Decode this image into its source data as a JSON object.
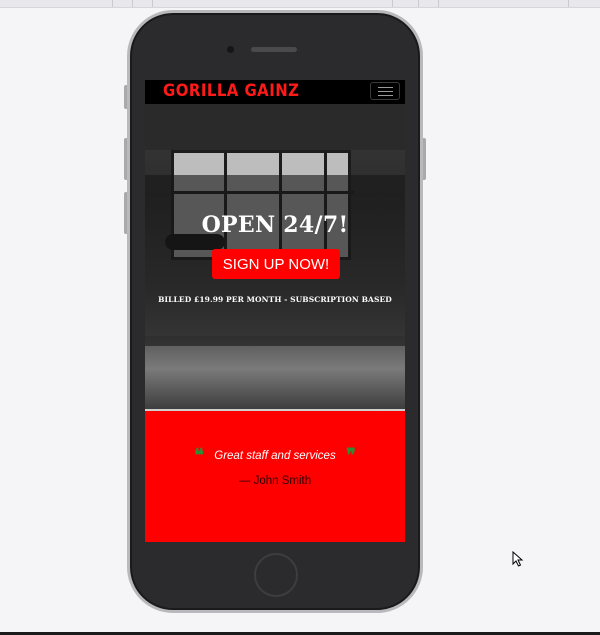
{
  "site": {
    "brand": "GORILLA GAINZ",
    "nav": {
      "toggle_icon": "hamburger-icon"
    }
  },
  "hero": {
    "title": "OPEN 24/7!",
    "cta_label": "SIGN UP NOW!",
    "billing_note": "BILLED £19.99 PER MONTH - SUBSCRIPTION BASED"
  },
  "testimonial": {
    "open_quote": "❝",
    "close_quote": "❞",
    "quote": "Great staff and services",
    "author": "— John Smith"
  },
  "colors": {
    "brand_red": "#ff0000",
    "quote_green": "#2e8b36",
    "phone_body": "#2b2b2d"
  }
}
